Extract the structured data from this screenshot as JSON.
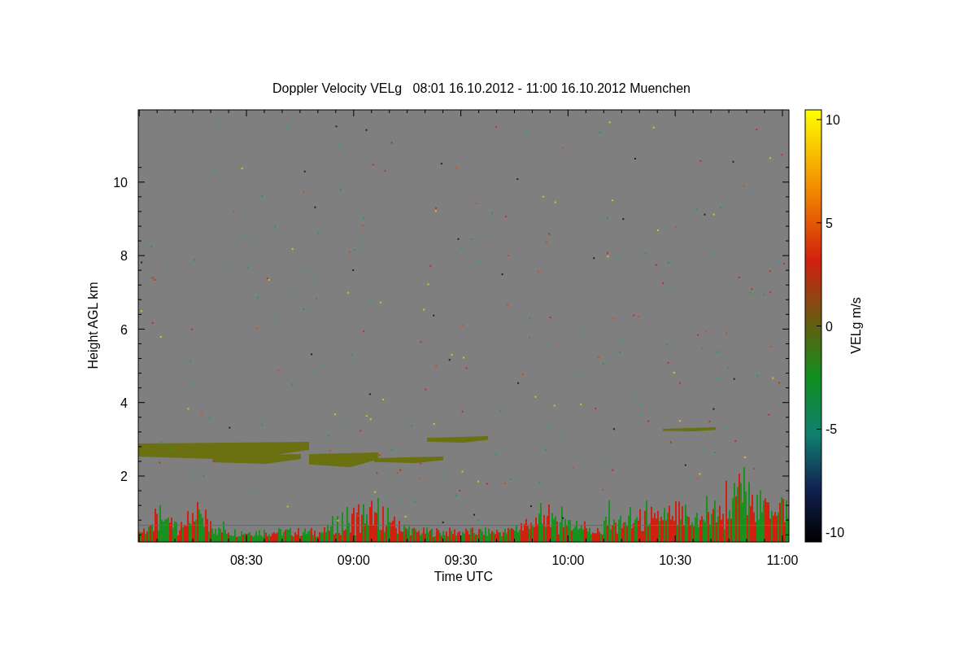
{
  "chart": {
    "title": "Doppler Velocity VELg   08:01 16.10.2012 - 11:00 16.10.2012 Muenchen",
    "xlabel": "Time UTC",
    "ylabel": "Height AGL km",
    "xticks": [
      "08:30",
      "09:00",
      "09:30",
      "10:00",
      "10:30",
      "11:00"
    ],
    "yticks": [
      "10",
      "8",
      "6",
      "4",
      "2"
    ]
  },
  "colorbar": {
    "label": "VELg m/s",
    "ticks": [
      "10",
      "5",
      "0",
      "-5",
      "-10"
    ]
  }
}
